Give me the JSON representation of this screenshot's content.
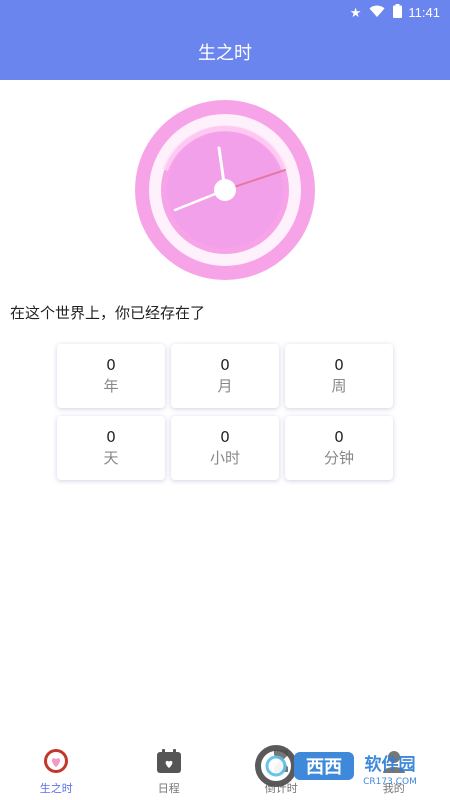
{
  "status_bar": {
    "time": "11:41"
  },
  "header": {
    "title": "生之时"
  },
  "main": {
    "caption": "在这个世界上，你已经存在了",
    "stats": [
      {
        "value": "0",
        "unit": "年"
      },
      {
        "value": "0",
        "unit": "月"
      },
      {
        "value": "0",
        "unit": "周"
      },
      {
        "value": "0",
        "unit": "天"
      },
      {
        "value": "0",
        "unit": "小时"
      },
      {
        "value": "0",
        "unit": "分钟"
      }
    ]
  },
  "tabs": [
    {
      "label": "生之时",
      "icon": "heart-clock-icon",
      "active": true
    },
    {
      "label": "日程",
      "icon": "calendar-heart-icon",
      "active": false
    },
    {
      "label": "倒计时",
      "icon": "hourglass-icon",
      "active": false
    },
    {
      "label": "我的",
      "icon": "profile-icon",
      "active": false
    }
  ],
  "watermark": {
    "text": "西西软件园",
    "site": "CR173.COM"
  },
  "colors": {
    "accent": "#6b85ee",
    "clock_outer": "#f7a3e8",
    "clock_inner": "#f3a0ea",
    "active_tab": "#5b72e6"
  }
}
